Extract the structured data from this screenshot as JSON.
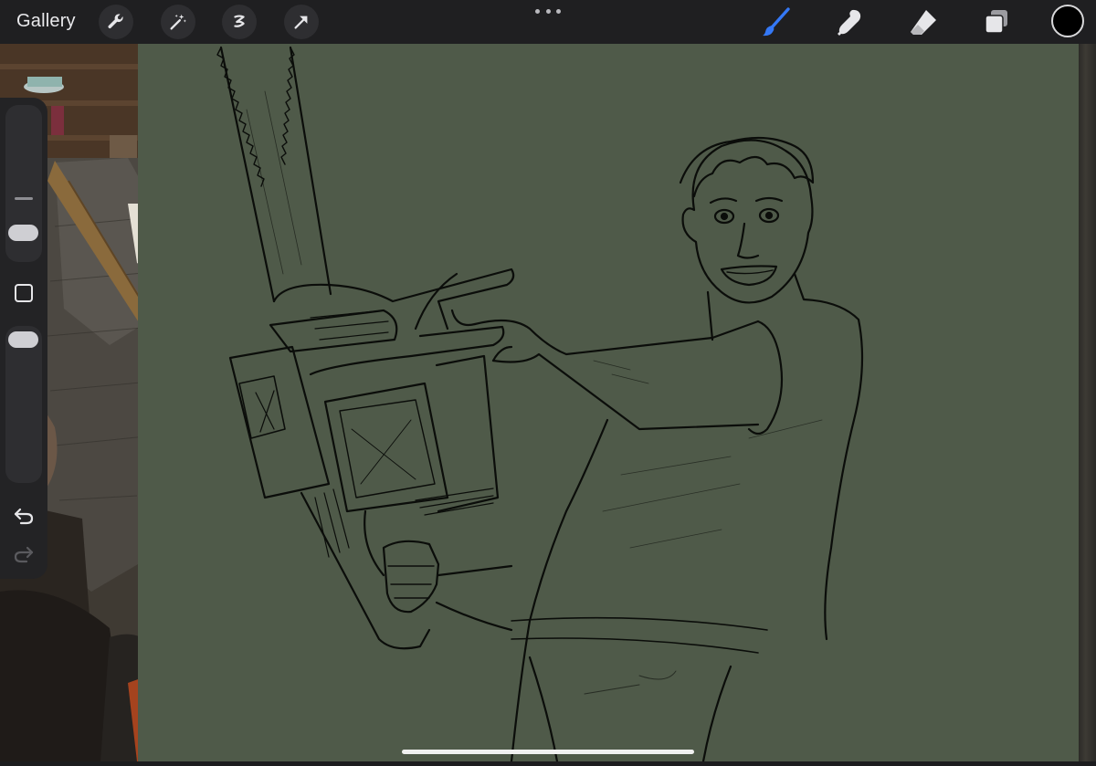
{
  "app": {
    "gallery_label": "Gallery"
  },
  "toolbar": {
    "left_tools": [
      "wrench-icon",
      "magic-wand-icon",
      "selection-icon",
      "transform-arrow-icon"
    ],
    "right_tools": [
      "brush-icon",
      "smudge-icon",
      "eraser-icon",
      "layers-icon"
    ],
    "active_tool": "brush-icon",
    "accent_color": "#3478f6",
    "current_color": "#000000"
  },
  "sidebar": {
    "size_slider_fraction": 0.28,
    "opacity_slider_fraction": 0.08,
    "controls": [
      "modify-square-icon",
      "undo-icon",
      "redo-icon"
    ]
  },
  "canvas": {
    "background_color": "#4f5a49",
    "stroke_color": "#0b0d0a"
  }
}
